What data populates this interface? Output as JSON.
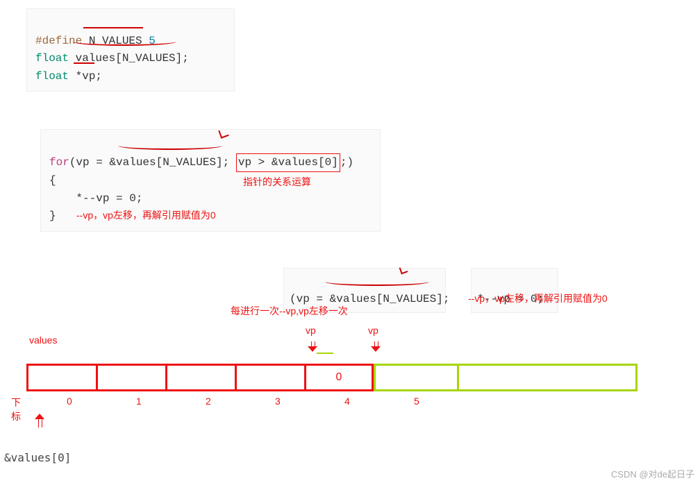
{
  "code1": {
    "line1_pre": "#define",
    "line1_name": " N_VALUES ",
    "line1_val": "5",
    "line2_type": "float",
    "line2_rest": " values[N_VALUES];",
    "line3_type": "float",
    "line3_rest": " *vp;"
  },
  "code2": {
    "for_kw": "for",
    "part1": "(vp = &values[N_VALUES]; ",
    "cond": "vp > &values[0]",
    "part2": ";)",
    "open": "{",
    "body": "    *--vp = 0;",
    "close": "}"
  },
  "anno": {
    "relational": "指针的关系运算",
    "decr_vp": "--vp，vp左移，再解引用赋值为0",
    "each_iter": "每进行一次--vp,vp左移一次",
    "vp_label_a": "vp",
    "vp_label_b": "vp",
    "values_label": "values",
    "index_label": "下标",
    "addr0": "&values[0]"
  },
  "code3": {
    "snippet1": "(vp = &values[N_VALUES];",
    "snippet2": "*--vp = 0;"
  },
  "cells": {
    "fill": "0",
    "indices": [
      "0",
      "1",
      "2",
      "3",
      "4",
      "5"
    ]
  },
  "watermark": "CSDN @对de起日子"
}
